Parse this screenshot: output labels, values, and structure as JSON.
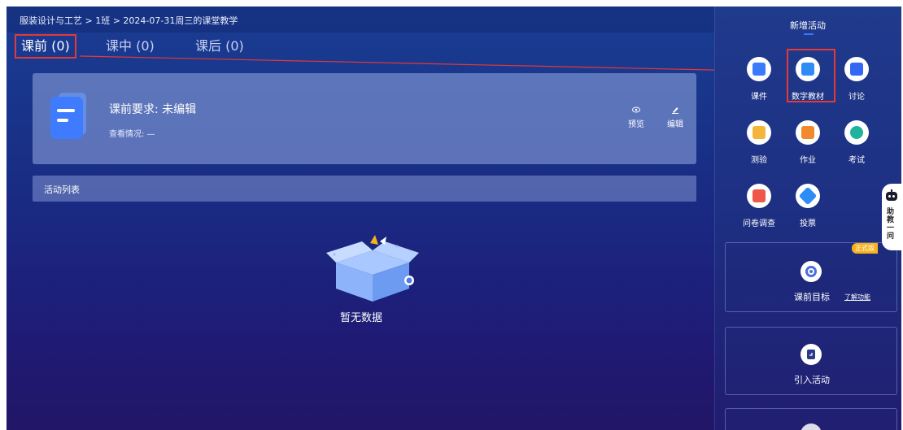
{
  "breadcrumb": "服装设计与工艺 > 1班 > 2024-07-31周三的课堂教学",
  "tabs": [
    {
      "label": "课前 (0)",
      "active": true
    },
    {
      "label": "课中 (0)",
      "active": false
    },
    {
      "label": "课后 (0)",
      "active": false
    }
  ],
  "pre_class": {
    "requirement": "课前要求: 未编辑",
    "view_status": "查看情况: —",
    "preview_label": "预览",
    "edit_label": "编辑"
  },
  "activity_list_label": "活动列表",
  "empty_text": "暂无数据",
  "sidebar": {
    "title": "新增活动",
    "tools": [
      {
        "label": "课件",
        "icon": "courseware-icon",
        "color": "#3a7bfd"
      },
      {
        "label": "数字教材",
        "icon": "digital-textbook-icon",
        "color": "#2f8cf5"
      },
      {
        "label": "讨论",
        "icon": "discussion-icon",
        "color": "#3568f2"
      },
      {
        "label": "测验",
        "icon": "quiz-icon",
        "color": "#f3b63a"
      },
      {
        "label": "作业",
        "icon": "homework-icon",
        "color": "#f08a2c"
      },
      {
        "label": "考试",
        "icon": "exam-icon",
        "color": "#1fb39c"
      },
      {
        "label": "问卷调查",
        "icon": "survey-icon",
        "color": "#f0574b"
      },
      {
        "label": "投票",
        "icon": "vote-icon",
        "color": "#2f8cf5"
      }
    ],
    "goal_label": "课前目标",
    "learn_more": "了解功能",
    "formal_tag": "正式版",
    "import_label": "引入活动"
  },
  "helper": {
    "text": "助教一问",
    "icon": "robot-icon"
  },
  "colors": {
    "highlight": "#e53935",
    "accent": "#2f7bff"
  }
}
